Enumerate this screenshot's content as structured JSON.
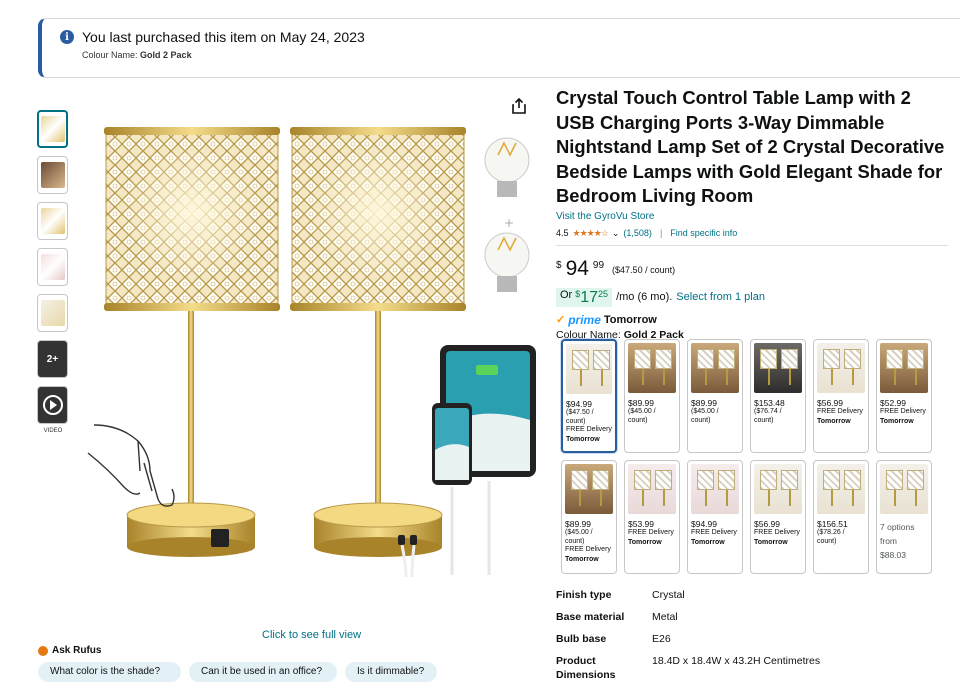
{
  "banner": {
    "message": "You last purchased this item on May 24, 2023",
    "colour_label": "Colour Name:",
    "colour_value": "Gold 2 Pack"
  },
  "thumbnails": {
    "more_label": "2+",
    "video_label": "VIDEO"
  },
  "gallery": {
    "zoom_link": "Click to see full view"
  },
  "rufus": {
    "label": "Ask Rufus",
    "chips": [
      "What color is the shade?",
      "Can it be used in an office?",
      "Is it dimmable?"
    ]
  },
  "product": {
    "title": "Crystal Touch Control Table Lamp with 2 USB Charging Ports 3-Way Dimmable Nightstand Lamp Set of 2 Crystal Decorative Bedside Lamps with Gold Elegant Shade for Bedroom Living Room",
    "store_link": "Visit the GyroVu Store",
    "rating": "4.5",
    "rating_stars": "★★★★☆",
    "rating_count": "(1,508)",
    "find_info": "Find specific info",
    "price_symbol": "$",
    "price_whole": "94",
    "price_fraction": "99",
    "unit_price": "($47.50 / count)",
    "emi_prefix": "Or",
    "emi_symbol": "$",
    "emi_whole": "17",
    "emi_fraction": "25",
    "emi_suffix": "/mo (6 mo).",
    "emi_link": "Select from 1 plan",
    "prime_label": "prime",
    "delivery": "Tomorrow",
    "colour_label": "Colour Name:",
    "colour_value": "Gold 2 Pack"
  },
  "swatches": [
    {
      "price": "$94.99",
      "sub": "($47.50 / count)",
      "delivery": "FREE Delivery",
      "day": "Tomorrow",
      "tone": "lt",
      "selected": true
    },
    {
      "price": "$89.99",
      "sub": "($45.00 / count)",
      "delivery": "",
      "day": "",
      "tone": "wm"
    },
    {
      "price": "$89.99",
      "sub": "($45.00 / count)",
      "delivery": "",
      "day": "",
      "tone": "wm"
    },
    {
      "price": "$153.48",
      "sub": "($76.74 / count)",
      "delivery": "",
      "day": "",
      "tone": "dk"
    },
    {
      "price": "$56.99",
      "sub": "",
      "delivery": "FREE Delivery",
      "day": "Tomorrow",
      "tone": "lt"
    },
    {
      "price": "$52.99",
      "sub": "",
      "delivery": "FREE Delivery",
      "day": "Tomorrow",
      "tone": "wm"
    },
    {
      "price": "$89.99",
      "sub": "($45.00 / count)",
      "delivery": "FREE Delivery",
      "day": "Tomorrow",
      "tone": "wm"
    },
    {
      "price": "$53.99",
      "sub": "",
      "delivery": "FREE Delivery",
      "day": "Tomorrow",
      "tone": "pk"
    },
    {
      "price": "$94.99",
      "sub": "",
      "delivery": "FREE Delivery",
      "day": "Tomorrow",
      "tone": "pk"
    },
    {
      "price": "$56.99",
      "sub": "",
      "delivery": "FREE Delivery",
      "day": "Tomorrow",
      "tone": "lt"
    },
    {
      "price": "$156.51",
      "sub": "($78.26 / count)",
      "delivery": "",
      "day": "",
      "tone": "lt"
    },
    {
      "options": "7 options from",
      "price_from": "$88.03",
      "tone": "lt"
    }
  ],
  "specs": [
    {
      "key": "Finish type",
      "value": "Crystal"
    },
    {
      "key": "Base material",
      "value": "Metal"
    },
    {
      "key": "Bulb base",
      "value": "E26"
    },
    {
      "key": "Product Dimensions",
      "value": "18.4D x 18.4W x 43.2H Centimetres"
    }
  ],
  "colors": {
    "link": "#007185",
    "banner_accent": "#2a5d9f",
    "star": "#de7921",
    "emi_green": "#0a7d4c",
    "prime_blue": "#1a98ff"
  }
}
